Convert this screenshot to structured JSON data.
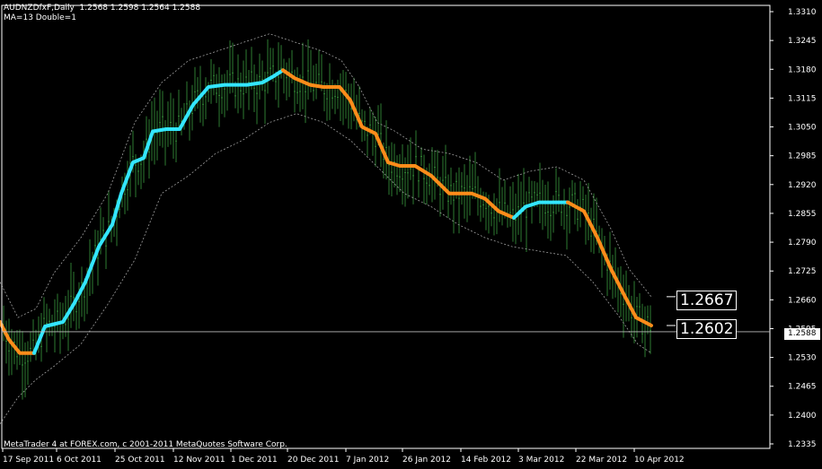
{
  "header": {
    "title": "AUDNZDfxF,Daily  1.2568 1.2598 1.2564 1.2588",
    "indicator": "MA=13 Double=1"
  },
  "footer": {
    "text": "MetaTrader 4 at FOREX.com, c 2001-2011 MetaQuotes Software Corp."
  },
  "labels": {
    "upper": "1.2667",
    "lower": "1.2602",
    "current_price": "1.2588"
  },
  "colors": {
    "background": "#000000",
    "candle": "#2e7d32",
    "ma_up": "#33e6ff",
    "ma_down": "#ff8c1a",
    "envelope": "#9e9e9e",
    "axis": "#ffffff"
  },
  "chart_data": {
    "type": "line",
    "y_axis": {
      "ticks": [
        "1.3310",
        "1.3245",
        "1.3180",
        "1.3115",
        "1.3050",
        "1.2985",
        "1.2920",
        "1.2855",
        "1.2790",
        "1.2725",
        "1.2660",
        "1.2595",
        "1.2530",
        "1.2465",
        "1.2400",
        "1.2335"
      ],
      "range": [
        1.2335,
        1.331
      ]
    },
    "x_axis": {
      "labels": [
        "17 Sep 2011",
        "6 Oct 2011",
        "25 Oct 2011",
        "12 Nov 2011",
        "1 Dec 2011",
        "20 Dec 2011",
        "7 Jan 2012",
        "26 Jan 2012",
        "14 Feb 2012",
        "3 Mar 2012",
        "22 Mar 2012",
        "10 Apr 2012"
      ]
    },
    "current_price": 1.2588,
    "ma_series": {
      "name": "MA=13",
      "values": [
        [
          0,
          1.261
        ],
        [
          10,
          1.257
        ],
        [
          22,
          1.254
        ],
        [
          38,
          1.254
        ],
        [
          50,
          1.26
        ],
        [
          60,
          1.2605
        ],
        [
          70,
          1.261
        ],
        [
          82,
          1.265
        ],
        [
          95,
          1.27
        ],
        [
          110,
          1.278
        ],
        [
          125,
          1.283
        ],
        [
          135,
          1.29
        ],
        [
          148,
          1.297
        ],
        [
          160,
          1.298
        ],
        [
          170,
          1.304
        ],
        [
          185,
          1.3045
        ],
        [
          200,
          1.3045
        ],
        [
          215,
          1.31
        ],
        [
          232,
          1.314
        ],
        [
          250,
          1.3145
        ],
        [
          275,
          1.3145
        ],
        [
          292,
          1.315
        ],
        [
          305,
          1.3165
        ],
        [
          315,
          1.3178
        ],
        [
          328,
          1.316
        ],
        [
          345,
          1.3145
        ],
        [
          360,
          1.314
        ],
        [
          378,
          1.314
        ],
        [
          390,
          1.311
        ],
        [
          403,
          1.305
        ],
        [
          418,
          1.3035
        ],
        [
          432,
          1.297
        ],
        [
          445,
          1.2962
        ],
        [
          462,
          1.2962
        ],
        [
          480,
          1.294
        ],
        [
          500,
          1.29
        ],
        [
          525,
          1.29
        ],
        [
          540,
          1.2888
        ],
        [
          555,
          1.286
        ],
        [
          572,
          1.2845
        ],
        [
          585,
          1.287
        ],
        [
          600,
          1.288
        ],
        [
          632,
          1.288
        ],
        [
          650,
          1.286
        ],
        [
          665,
          1.28
        ],
        [
          680,
          1.273
        ],
        [
          695,
          1.267
        ],
        [
          708,
          1.262
        ],
        [
          725,
          1.2602
        ]
      ],
      "color_split": [
        {
          "from": 0,
          "to": 38,
          "direction": "down"
        },
        {
          "from": 38,
          "to": 315,
          "direction": "up"
        },
        {
          "from": 315,
          "to": 572,
          "direction": "down"
        },
        {
          "from": 572,
          "to": 632,
          "direction": "up"
        },
        {
          "from": 632,
          "to": 725,
          "direction": "down"
        }
      ]
    },
    "envelope_upper": [
      [
        0,
        1.27
      ],
      [
        20,
        1.262
      ],
      [
        40,
        1.264
      ],
      [
        60,
        1.272
      ],
      [
        90,
        1.28
      ],
      [
        120,
        1.29
      ],
      [
        150,
        1.306
      ],
      [
        180,
        1.315
      ],
      [
        210,
        1.32
      ],
      [
        240,
        1.322
      ],
      [
        270,
        1.324
      ],
      [
        300,
        1.326
      ],
      [
        330,
        1.324
      ],
      [
        360,
        1.322
      ],
      [
        380,
        1.32
      ],
      [
        400,
        1.314
      ],
      [
        420,
        1.306
      ],
      [
        440,
        1.304
      ],
      [
        470,
        1.3
      ],
      [
        500,
        1.299
      ],
      [
        530,
        1.297
      ],
      [
        560,
        1.293
      ],
      [
        590,
        1.295
      ],
      [
        620,
        1.296
      ],
      [
        650,
        1.293
      ],
      [
        680,
        1.282
      ],
      [
        700,
        1.273
      ],
      [
        725,
        1.2667
      ]
    ],
    "envelope_lower": [
      [
        0,
        1.238
      ],
      [
        20,
        1.244
      ],
      [
        40,
        1.248
      ],
      [
        60,
        1.251
      ],
      [
        90,
        1.256
      ],
      [
        120,
        1.265
      ],
      [
        150,
        1.275
      ],
      [
        180,
        1.29
      ],
      [
        210,
        1.294
      ],
      [
        240,
        1.299
      ],
      [
        270,
        1.302
      ],
      [
        300,
        1.306
      ],
      [
        330,
        1.308
      ],
      [
        360,
        1.306
      ],
      [
        390,
        1.302
      ],
      [
        420,
        1.296
      ],
      [
        450,
        1.29
      ],
      [
        480,
        1.287
      ],
      [
        510,
        1.283
      ],
      [
        540,
        1.28
      ],
      [
        570,
        1.278
      ],
      [
        600,
        1.277
      ],
      [
        630,
        1.276
      ],
      [
        660,
        1.27
      ],
      [
        690,
        1.262
      ],
      [
        710,
        1.256
      ],
      [
        725,
        1.254
      ]
    ]
  }
}
